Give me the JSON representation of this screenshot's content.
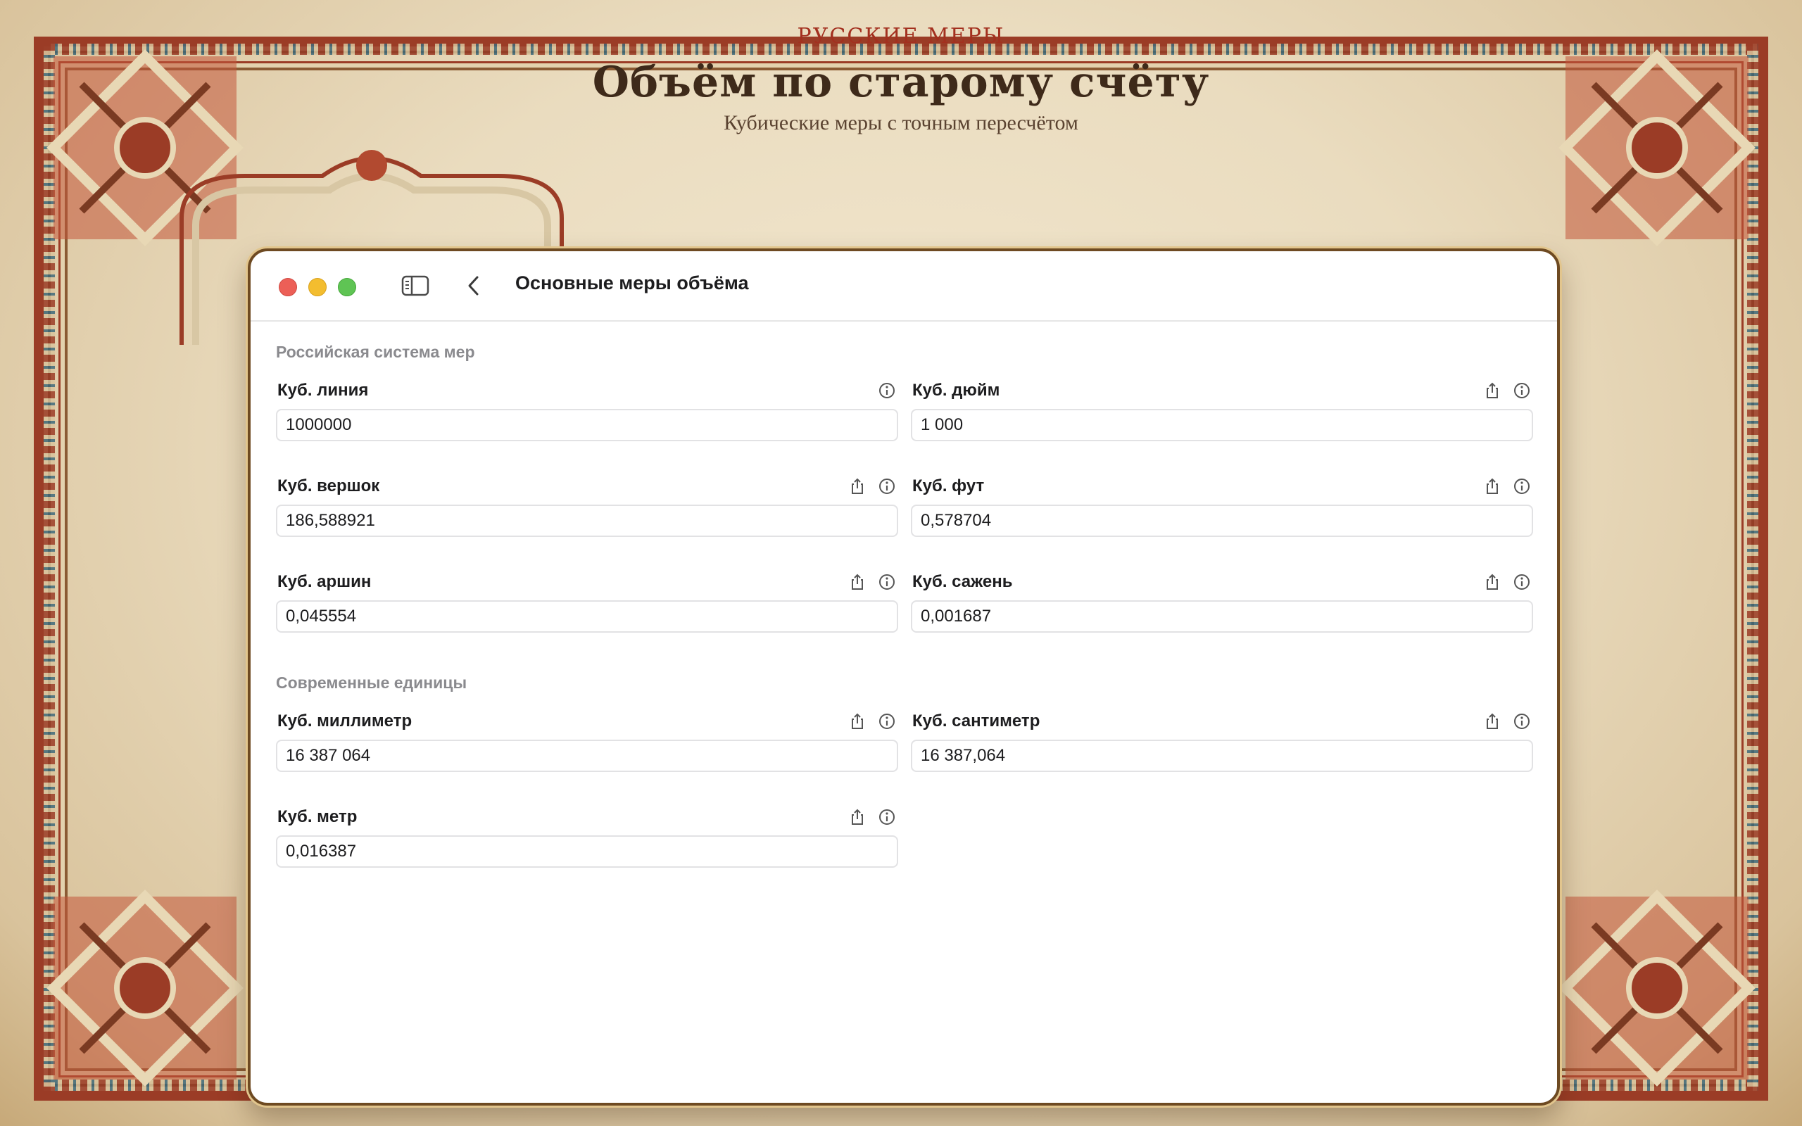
{
  "header": {
    "brand": "Русские меры",
    "title": "Объём по старому счёту",
    "subtitle": "Кубические меры с точным пересчётом"
  },
  "window": {
    "title": "Основные меры объёма",
    "sections": [
      {
        "title": "Российская система мер"
      },
      {
        "title": "Современные единицы"
      }
    ],
    "fields": [
      {
        "label": "Куб. линия",
        "value": "1000000"
      },
      {
        "label": "Куб. дюйм",
        "value": "1 000"
      },
      {
        "label": "Куб. вершок",
        "value": "186,588921"
      },
      {
        "label": "Куб. фут",
        "value": "0,578704"
      },
      {
        "label": "Куб. аршин",
        "value": "0,045554"
      },
      {
        "label": "Куб. сажень",
        "value": "0,001687"
      },
      {
        "label": "Куб. миллиметр",
        "value": "16 387 064"
      },
      {
        "label": "Куб. сантиметр",
        "value": "16 387,064"
      },
      {
        "label": "Куб. метр",
        "value": "0,016387"
      }
    ]
  },
  "icons": {
    "share": "share-icon",
    "info": "info-icon",
    "sidebar": "sidebar-toggle-icon",
    "back": "chevron-left-icon"
  },
  "colors": {
    "accent_red": "#9b3c26",
    "close": "#ec5f57",
    "minimize": "#f3bd2f",
    "zoom": "#5fc454"
  }
}
